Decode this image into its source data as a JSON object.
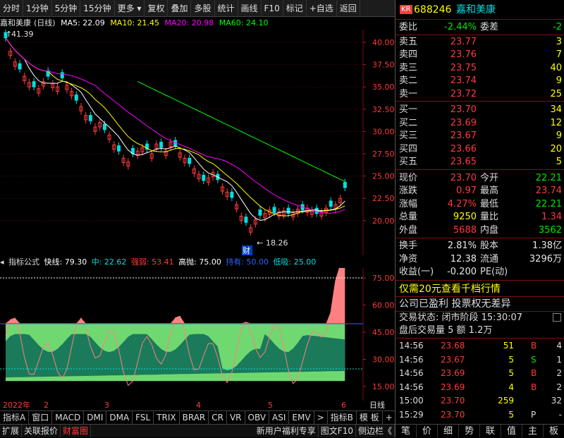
{
  "toolbar": {
    "items": [
      "分时",
      "1分钟",
      "5分钟",
      "15分钟",
      "更多",
      "复权",
      "叠加",
      "多股",
      "统计",
      "画线",
      "F10",
      "标记",
      "自选",
      "返回"
    ]
  },
  "chart_header": {
    "stock_name": "嘉和美康",
    "period": "(日线)",
    "ma5_label": "MA5: 22.09",
    "ma10_label": "MA10: 21.45",
    "ma20_label": "MA20: 20.98",
    "ma60_label": "MA60: 24.10",
    "high_label": "41.39",
    "low_label": "18.26",
    "event_marker": "财"
  },
  "colors": {
    "ma5": "#ffffff",
    "ma10": "#ffff00",
    "ma20": "#ff00ff",
    "ma60": "#00ff00",
    "up": "#ff3a3a",
    "down": "#00e0e0",
    "grid": "#7a1010"
  },
  "price_axis": [
    "40.00",
    "37.50",
    "35.00",
    "32.50",
    "30.00",
    "27.50",
    "25.00",
    "22.50",
    "20.00"
  ],
  "indicator": {
    "name": "指标公式",
    "fast_label": "快线: 79.30",
    "mid_label": "中: 22.62",
    "strong_label": "强弱: 53.41",
    "high_throw_label": "高抛: 75.00",
    "hold_label": "持有: 50.00",
    "low_absorb_label": "低吸: 25.00",
    "axis": [
      "75.00",
      "60.00",
      "45.00",
      "30.00",
      "15.00"
    ]
  },
  "time_axis": {
    "labels": [
      "2022年",
      "2",
      "3",
      "4",
      "5",
      "6"
    ],
    "period_label": "日线"
  },
  "bottom_tabs": [
    "指标A",
    "窗口",
    "MACD",
    "DMI",
    "DMA",
    "FSL",
    "TRIX",
    "BRAR",
    "CR",
    "VR",
    "OBV",
    "ASI",
    "EMV",
    ">",
    "指标B",
    "模 板",
    "+",
    "-"
  ],
  "bottom_bar": [
    "扩展",
    "关联报价",
    "财富圈",
    "新用户福利专享",
    "图文F10",
    "侧边栏《"
  ],
  "quote": {
    "badge": "KR",
    "code": "688246",
    "name": "嘉和美康",
    "commission_ratio_label": "委比",
    "commission_ratio": "-2.44%",
    "commission_diff_label": "委差",
    "commission_diff": "-2",
    "asks": [
      {
        "label": "卖五",
        "price": "23.77",
        "vol": "3"
      },
      {
        "label": "卖四",
        "price": "23.76",
        "vol": "7"
      },
      {
        "label": "卖三",
        "price": "23.75",
        "vol": "40"
      },
      {
        "label": "卖二",
        "price": "23.74",
        "vol": "9"
      },
      {
        "label": "卖一",
        "price": "23.72",
        "vol": "25"
      }
    ],
    "bids": [
      {
        "label": "买一",
        "price": "23.70",
        "vol": "34"
      },
      {
        "label": "买二",
        "price": "23.69",
        "vol": "12"
      },
      {
        "label": "买三",
        "price": "23.67",
        "vol": "9"
      },
      {
        "label": "买四",
        "price": "23.66",
        "vol": "20"
      },
      {
        "label": "买五",
        "price": "23.65",
        "vol": "5"
      }
    ],
    "stats": [
      {
        "l1": "现价",
        "v1": "23.70",
        "c1": "red",
        "l2": "今开",
        "v2": "22.21",
        "c2": "green"
      },
      {
        "l1": "涨跌",
        "v1": "0.97",
        "c1": "red",
        "l2": "最高",
        "v2": "23.74",
        "c2": "red"
      },
      {
        "l1": "涨幅",
        "v1": "4.27%",
        "c1": "red",
        "l2": "最低",
        "v2": "22.21",
        "c2": "green"
      },
      {
        "l1": "总量",
        "v1": "9250",
        "c1": "yellow",
        "l2": "量比",
        "v2": "1.34",
        "c2": "red"
      },
      {
        "l1": "外盘",
        "v1": "5688",
        "c1": "red",
        "l2": "内盘",
        "v2": "3562",
        "c2": "green"
      }
    ],
    "stats2": [
      {
        "l1": "换手",
        "v1": "2.81%",
        "l2": "股本",
        "v2": "1.38亿"
      },
      {
        "l1": "净资",
        "v1": "12.38",
        "l2": "流通",
        "v2": "3296万"
      },
      {
        "l1": "收益(一)",
        "v1": "-0.200",
        "l2": "PE(动)",
        "v2": ""
      }
    ],
    "promo": "仅需20元查看千档行情",
    "info1": "公司已盈利 投票权无差异",
    "info2": "交易状态: 闭市阶段 15:30:07",
    "info3": "盘后交易量 5 额 1.2万",
    "ticks": [
      {
        "time": "14:56",
        "price": "23.68",
        "vol": "51",
        "bs": "B",
        "n": "4"
      },
      {
        "time": "14:56",
        "price": "23.67",
        "vol": "5",
        "bs": "S",
        "n": "1"
      },
      {
        "time": "14:56",
        "price": "23.69",
        "vol": "5",
        "bs": "B",
        "n": "2"
      },
      {
        "time": "14:56",
        "price": "23.69",
        "vol": "4",
        "bs": "B",
        "n": "2"
      },
      {
        "time": "15:00",
        "price": "23.70",
        "vol": "259",
        "bs": "",
        "n": "32"
      },
      {
        "time": "15:29",
        "price": "23.70",
        "vol": "5",
        "bs": "P",
        "n": "-"
      }
    ],
    "tabs": [
      "笔",
      "价",
      "细",
      "势",
      "联",
      "值",
      "主",
      "板"
    ]
  }
}
